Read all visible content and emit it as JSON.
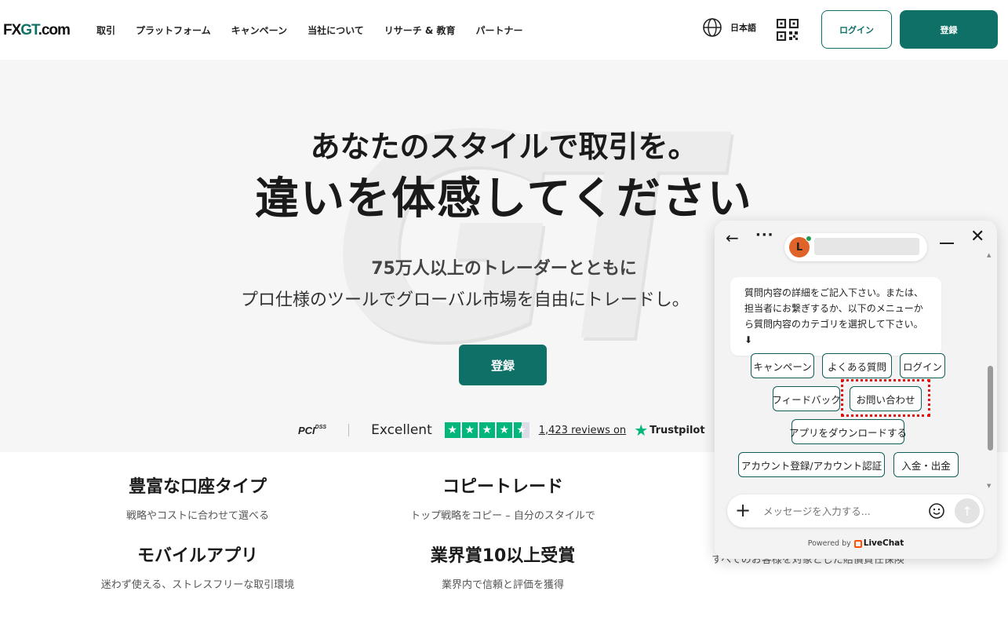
{
  "brand": {
    "logo_fx": "FX",
    "logo_gt": "GT",
    "logo_com": ".com",
    "accent": "#0e7067"
  },
  "nav": {
    "items": [
      "取引",
      "プラットフォーム",
      "キャンペーン",
      "当社について",
      "リサーチ & 教育",
      "パートナー"
    ]
  },
  "header": {
    "language": "日本語",
    "login": "ログイン",
    "register": "登録"
  },
  "hero": {
    "watermark": "GT",
    "title1": "あなたのスタイルで取引を。",
    "title2": "違いを体感してください",
    "sub1": "75万人以上のトレーダーとともに",
    "sub2": "プロ仕様のツールでグローバル市場を自由にトレードし。",
    "cta": "登録"
  },
  "trust": {
    "pci": "PCI",
    "pci_small": "DSS",
    "rating_text": "Excellent",
    "stars": 4.5,
    "reviews": "1,423 reviews on",
    "trustpilot": "Trustpilot"
  },
  "features": [
    {
      "title": "豊富な口座タイプ",
      "desc": "戦略やコストに合わせて選べる"
    },
    {
      "title": "コピートレード",
      "desc": "トップ戦略をコピー – 自分のスタイルで"
    },
    {
      "title": "モバイルアプリ",
      "desc": "迷わず使える、ストレスフリーな取引環境"
    },
    {
      "title": "業界賞10以上受賞",
      "desc": "業界内で信頼と評価を獲得"
    },
    {
      "title": "",
      "desc": "すべてのお客様を対象とした賠償責任保険"
    }
  ],
  "chat": {
    "agent_initial": "L",
    "message": "質問内容の詳細をご記入下さい。または、担当者にお繋ぎするか、以下のメニューから質問内容のカテゴリを選択して下さい。⬇",
    "quick_replies": [
      "キャンペーン",
      "よくある質問",
      "ログイン",
      "フィードバック",
      "お問い合わせ",
      "アプリをダウンロードする",
      "アカウント登録/アカウント認証",
      "入金・出金"
    ],
    "input_placeholder": "メッセージを入力する...",
    "powered_by": "Powered by",
    "provider": "LiveChat"
  }
}
